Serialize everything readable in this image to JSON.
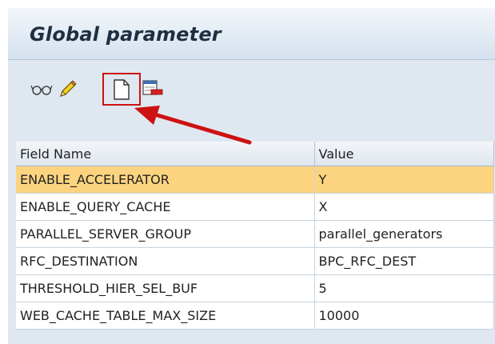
{
  "window": {
    "title": "Global parameter"
  },
  "toolbar": {
    "buttons": [
      {
        "icon": "glasses-icon",
        "action": "display"
      },
      {
        "icon": "pencil-icon",
        "action": "change"
      },
      {
        "icon": "new-document-icon",
        "action": "create",
        "highlighted": true
      },
      {
        "icon": "delete-entry-icon",
        "action": "delete"
      }
    ]
  },
  "table": {
    "columns": [
      "Field Name",
      "Value"
    ],
    "rows": [
      {
        "field": "ENABLE_ACCELERATOR",
        "value": "Y",
        "selected": true
      },
      {
        "field": "ENABLE_QUERY_CACHE",
        "value": "X"
      },
      {
        "field": "PARALLEL_SERVER_GROUP",
        "value": "parallel_generators"
      },
      {
        "field": "RFC_DESTINATION",
        "value": "BPC_RFC_DEST"
      },
      {
        "field": "THRESHOLD_HIER_SEL_BUF",
        "value": "5"
      },
      {
        "field": "WEB_CACHE_TABLE_MAX_SIZE",
        "value": "10000"
      }
    ]
  },
  "colors": {
    "selected_row": "#fcd480",
    "highlight": "#cc1212",
    "background": "#dfe8f1"
  }
}
